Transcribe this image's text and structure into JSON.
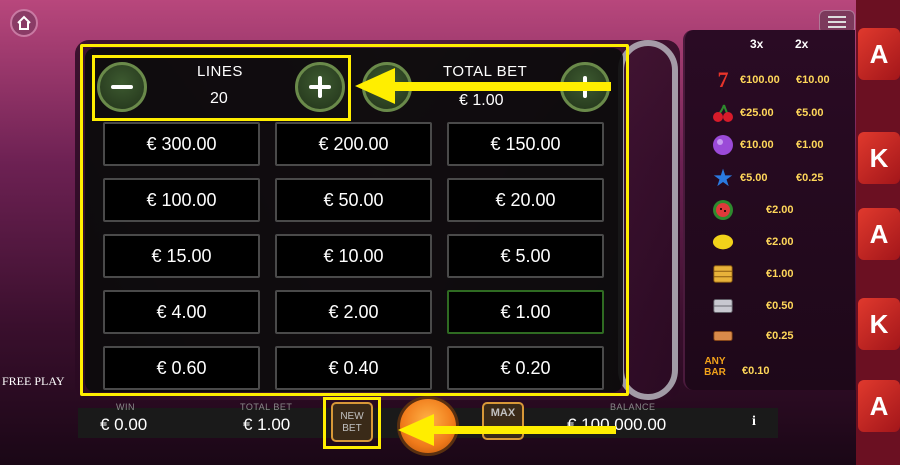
{
  "top": {
    "home_icon": "home-icon",
    "menu_icon": "hamburger-icon"
  },
  "paytable": {
    "col_3x": "3x",
    "col_2x": "2x",
    "rows": [
      {
        "symbol": "seven-icon",
        "v3": "€100.00",
        "v2": "€10.00"
      },
      {
        "symbol": "cherry-icon",
        "v3": "€25.00",
        "v2": "€5.00"
      },
      {
        "symbol": "plum-icon",
        "v3": "€10.00",
        "v2": "€1.00"
      },
      {
        "symbol": "star-icon",
        "v3": "€5.00",
        "v2": "€0.25"
      },
      {
        "symbol": "watermelon-icon",
        "value": "€2.00"
      },
      {
        "symbol": "lemon-icon",
        "value": "€2.00"
      },
      {
        "symbol": "gold-bar-icon",
        "value": "€1.00"
      },
      {
        "symbol": "silver-bar-icon",
        "value": "€0.50"
      },
      {
        "symbol": "bronze-bar-icon",
        "value": "€0.25"
      },
      {
        "symbol": "any-bar-icon",
        "any_bar_label_1": "ANY",
        "any_bar_label_2": "BAR",
        "value": "€0.10"
      }
    ]
  },
  "bet_panel": {
    "lines_label": "LINES",
    "lines_value": "20",
    "total_bet_label": "TOTAL BET",
    "total_bet_value": "€ 1.00",
    "selected_index": 11,
    "options": [
      "€ 300.00",
      "€ 200.00",
      "€ 150.00",
      "€ 100.00",
      "€ 50.00",
      "€ 20.00",
      "€ 15.00",
      "€ 10.00",
      "€ 5.00",
      "€ 4.00",
      "€ 2.00",
      "€ 1.00",
      "€ 0.60",
      "€ 0.40",
      "€ 0.20"
    ]
  },
  "bottom": {
    "free_play": "FREE PLAY",
    "win_label": "WIN",
    "win_value": "€ 0.00",
    "total_bet_label": "TOTAL BET",
    "total_bet_value": "€ 1.00",
    "new_bet_line1": "NEW",
    "new_bet_line2": "BET",
    "max_label": "MAX",
    "balance_label": "BALANCE",
    "balance_value": "€ 100,000.00",
    "info_label": "i"
  },
  "side_dice": [
    "A",
    "K",
    "A",
    "K",
    "A"
  ],
  "colors": {
    "highlight": "#ffee00",
    "payout": "#ffd75a",
    "selected_border": "#2f6b22"
  }
}
